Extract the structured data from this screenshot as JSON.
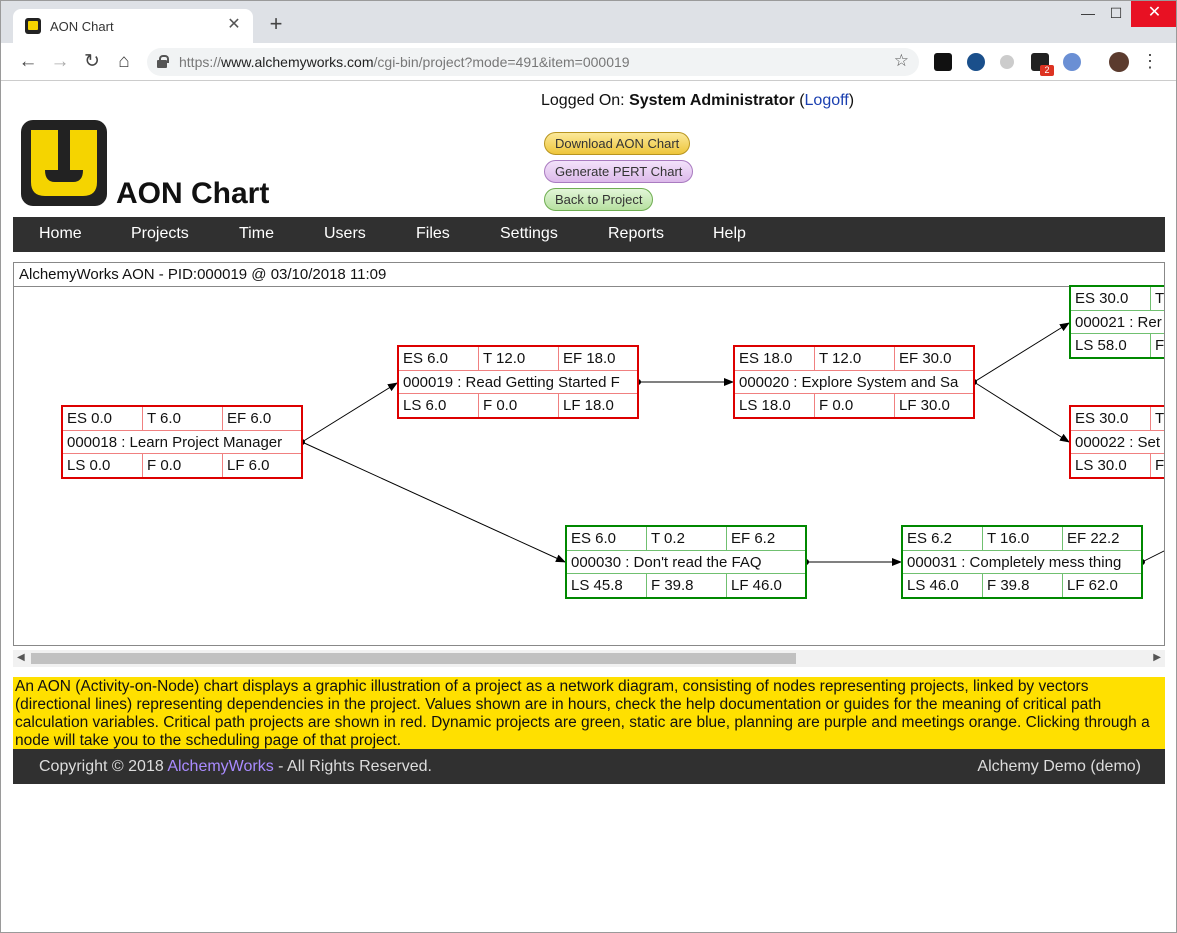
{
  "browser": {
    "tab_title": "AON Chart",
    "tab_close": "✕",
    "new_tab": "+",
    "url_prefix": "https://",
    "url_host": "www.alchemyworks.com",
    "url_path": "/cgi-bin/project?mode=491&item=000019",
    "ext_badge": "2"
  },
  "header": {
    "title": "AON Chart",
    "logged_on_label": "Logged On:",
    "user": "System Administrator",
    "logoff": "Logoff"
  },
  "actions": {
    "download": "Download AON Chart",
    "pert": "Generate PERT Chart",
    "back": "Back to Project"
  },
  "nav": [
    "Home",
    "Projects",
    "Time",
    "Users",
    "Files",
    "Settings",
    "Reports",
    "Help"
  ],
  "panel": {
    "title": "AlchemyWorks AON - PID:000019 @ 03/10/2018 11:09"
  },
  "nodes": [
    {
      "id": "n18",
      "es": "ES 0.0",
      "t": "T 6.0",
      "ef": "EF 6.0",
      "name": "000018 : Learn Project Manager",
      "ls": "LS 0.0",
      "f": "F 0.0",
      "lf": "LF 6.0"
    },
    {
      "id": "n19",
      "es": "ES 6.0",
      "t": "T 12.0",
      "ef": "EF 18.0",
      "name": "000019 : Read Getting Started F",
      "ls": "LS 6.0",
      "f": "F 0.0",
      "lf": "LF 18.0"
    },
    {
      "id": "n20",
      "es": "ES 18.0",
      "t": "T 12.0",
      "ef": "EF 30.0",
      "name": "000020 : Explore System and Sa",
      "ls": "LS 18.0",
      "f": "F 0.0",
      "lf": "LF 30.0"
    },
    {
      "id": "n21",
      "es": "ES 30.0",
      "t": "T",
      "ef": "",
      "name": "000021 : Rer",
      "ls": "LS 58.0",
      "f": "F",
      "lf": ""
    },
    {
      "id": "n22",
      "es": "ES 30.0",
      "t": "T",
      "ef": "",
      "name": "000022 : Set",
      "ls": "LS 30.0",
      "f": "F",
      "lf": ""
    },
    {
      "id": "n30",
      "es": "ES 6.0",
      "t": "T 0.2",
      "ef": "EF 6.2",
      "name": "000030 : Don't read the FAQ",
      "ls": "LS 45.8",
      "f": "F 39.8",
      "lf": "LF 46.0"
    },
    {
      "id": "n31",
      "es": "ES 6.2",
      "t": "T 16.0",
      "ef": "EF 22.2",
      "name": "000031 : Completely mess thing",
      "ls": "LS 46.0",
      "f": "F 39.8",
      "lf": "LF 62.0"
    }
  ],
  "description": "An AON (Activity-on-Node) chart displays a graphic illustration of a project as a network diagram, consisting of nodes representing projects, linked by vectors (directional lines) representing dependencies in the project. Values shown are in hours, check the help documentation or guides for the meaning of critical path calculation variables. Critical path projects are shown in red. Dynamic projects are green, static are blue, planning are purple and meetings orange. Clicking through a node will take you to the scheduling page of that project.",
  "footer": {
    "copyright_prefix": "Copyright © 2018 ",
    "brand": "AlchemyWorks",
    "copyright_suffix": " - All Rights Reserved.",
    "account": "Alchemy Demo (demo)"
  },
  "colors": {
    "critical": "#dd0000",
    "dynamic": "#008800",
    "nav_bg": "#303030",
    "note_bg": "#ffe000"
  }
}
